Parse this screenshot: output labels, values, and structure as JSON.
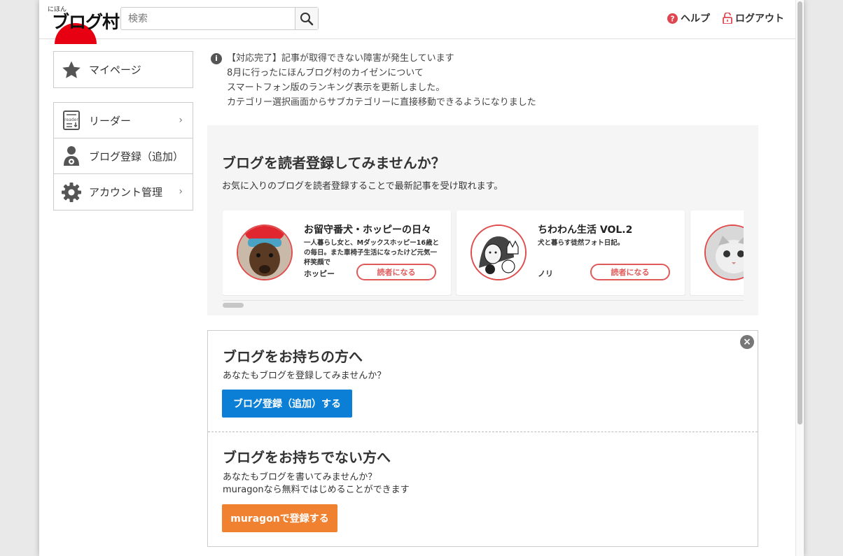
{
  "header": {
    "logo_small": "にほん",
    "logo_main": "ブログ村",
    "search_placeholder": "検索",
    "help_label": "ヘルプ",
    "logout_label": "ログアウト"
  },
  "sidebar": {
    "mypage_label": "マイページ",
    "items": [
      {
        "label": "リーダー",
        "icon": "reader-icon",
        "chevron": "›"
      },
      {
        "label": "ブログ登録（追加）",
        "icon": "user-gear-icon",
        "chevron": ""
      },
      {
        "label": "アカウント管理",
        "icon": "gear-icon",
        "chevron": "›"
      }
    ]
  },
  "notices": {
    "info_glyph": "i",
    "items": [
      "【対応完了】記事が取得できない障害が発生しています",
      "8月に行ったにほんブログ村のカイゼンについて",
      "スマートフォン版のランキング表示を更新しました。",
      "カテゴリー選択画面からサブカテゴリーに直接移動できるようになりました"
    ]
  },
  "reader_section": {
    "title": "ブログを読者登録してみませんか？",
    "description": "お気に入りのブログを読者登録することで最新記事を受け取れます。",
    "cards": [
      {
        "title": "お留守番犬・ホッピーの日々",
        "description": "一人暮らし女と、Mダックスホッピー16歳との毎日。また車椅子生活になったけど元気一杯笑顔で",
        "author": "ホッピー",
        "button_label": "読者になる"
      },
      {
        "title": "ちわわん生活 VOL.2",
        "description": "犬と暮らす徒然フォト日記。",
        "author": "ノリ",
        "button_label": "読者になる"
      }
    ]
  },
  "blog_section": {
    "close_glyph": "×",
    "has_blog_title": "ブログをお持ちの方へ",
    "has_blog_text": "あなたもブログを登録してみませんか？",
    "has_blog_button": "ブログ登録（追加）する",
    "no_blog_title": "ブログをお持ちでない方へ",
    "no_blog_text1": "あなたもブログを書いてみませんか？",
    "no_blog_text2": "muragonなら無料ではじめることができます",
    "no_blog_button": "muragonで登録する"
  },
  "colors": {
    "brand_red": "#e60012",
    "primary_blue": "#0b7fd6",
    "muragon_orange": "#f08130",
    "follow_red": "#e05a5a"
  }
}
